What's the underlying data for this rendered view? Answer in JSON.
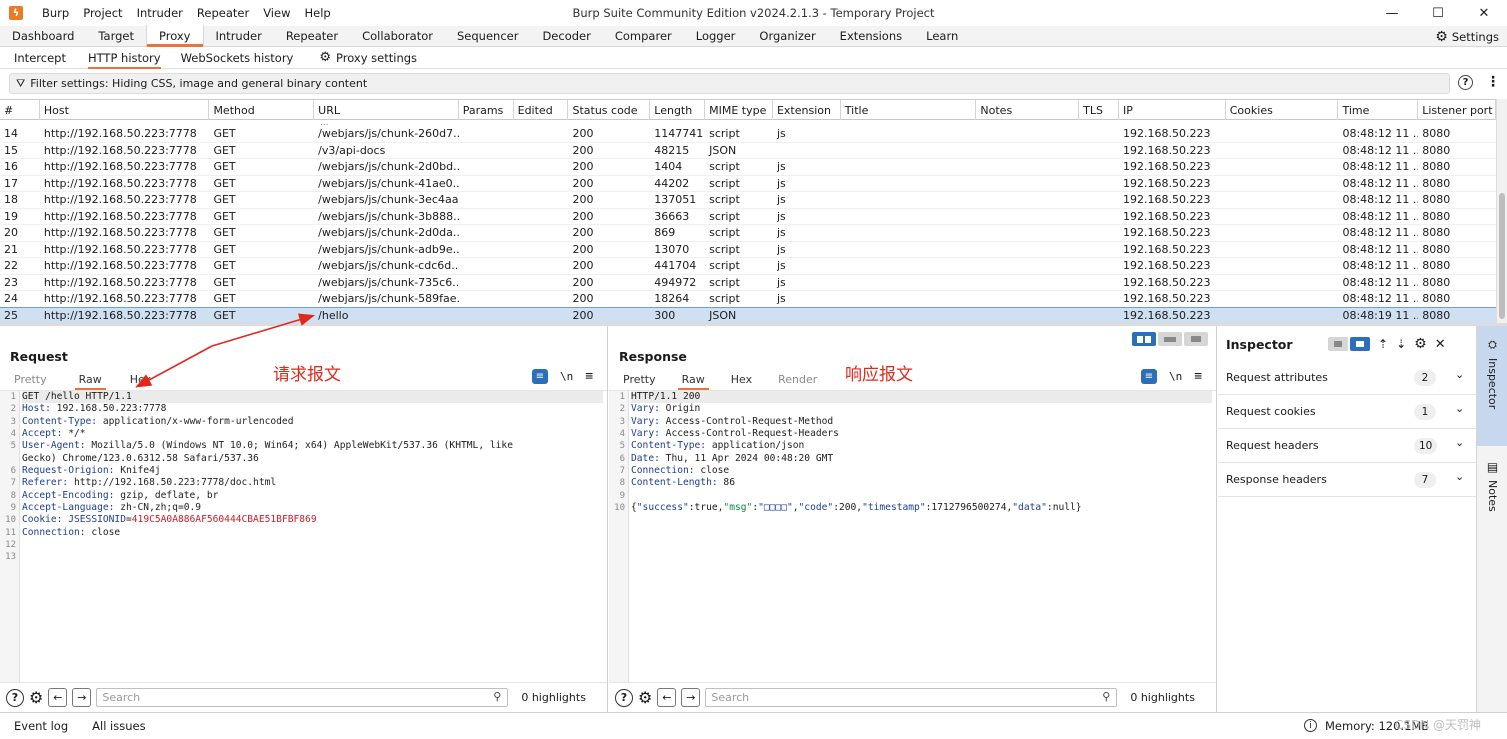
{
  "window": {
    "title": "Burp Suite Community Edition v2024.2.1.3 - Temporary Project",
    "menu": [
      "Burp",
      "Project",
      "Intruder",
      "Repeater",
      "View",
      "Help"
    ],
    "minimize": "—",
    "maximize": "☐",
    "close": "✕"
  },
  "main_tabs": [
    "Dashboard",
    "Target",
    "Proxy",
    "Intruder",
    "Repeater",
    "Collaborator",
    "Sequencer",
    "Decoder",
    "Comparer",
    "Logger",
    "Organizer",
    "Extensions",
    "Learn"
  ],
  "active_main_tab": "Proxy",
  "settings_label": "Settings",
  "sub_tabs": {
    "intercept": "Intercept",
    "http_history": "HTTP history",
    "websockets": "WebSockets history",
    "proxy_settings": "Proxy settings"
  },
  "filter": {
    "text": "Filter settings: Hiding CSS, image and general binary content"
  },
  "table": {
    "columns": [
      "#",
      "Host",
      "Method",
      "URL",
      "Params",
      "Edited",
      "Status code",
      "Length",
      "MIME type",
      "Extension",
      "Title",
      "Notes",
      "TLS",
      "IP",
      "Cookies",
      "Time",
      "Listener port"
    ],
    "partial_row": "...",
    "rows": [
      [
        "14",
        "http://192.168.50.223:7778",
        "GET",
        "/webjars/js/chunk-260d7...",
        "",
        "",
        "200",
        "1147741",
        "script",
        "js",
        "",
        "",
        "",
        "192.168.50.223",
        "",
        "08:48:12 11 ...",
        "8080"
      ],
      [
        "15",
        "http://192.168.50.223:7778",
        "GET",
        "/v3/api-docs",
        "",
        "",
        "200",
        "48215",
        "JSON",
        "",
        "",
        "",
        "",
        "192.168.50.223",
        "",
        "08:48:12 11 ...",
        "8080"
      ],
      [
        "16",
        "http://192.168.50.223:7778",
        "GET",
        "/webjars/js/chunk-2d0bd...",
        "",
        "",
        "200",
        "1404",
        "script",
        "js",
        "",
        "",
        "",
        "192.168.50.223",
        "",
        "08:48:12 11 ...",
        "8080"
      ],
      [
        "17",
        "http://192.168.50.223:7778",
        "GET",
        "/webjars/js/chunk-41ae0...",
        "",
        "",
        "200",
        "44202",
        "script",
        "js",
        "",
        "",
        "",
        "192.168.50.223",
        "",
        "08:48:12 11 ...",
        "8080"
      ],
      [
        "18",
        "http://192.168.50.223:7778",
        "GET",
        "/webjars/js/chunk-3ec4aa...",
        "",
        "",
        "200",
        "137051",
        "script",
        "js",
        "",
        "",
        "",
        "192.168.50.223",
        "",
        "08:48:12 11 ...",
        "8080"
      ],
      [
        "19",
        "http://192.168.50.223:7778",
        "GET",
        "/webjars/js/chunk-3b888...",
        "",
        "",
        "200",
        "36663",
        "script",
        "js",
        "",
        "",
        "",
        "192.168.50.223",
        "",
        "08:48:12 11 ...",
        "8080"
      ],
      [
        "20",
        "http://192.168.50.223:7778",
        "GET",
        "/webjars/js/chunk-2d0da...",
        "",
        "",
        "200",
        "869",
        "script",
        "js",
        "",
        "",
        "",
        "192.168.50.223",
        "",
        "08:48:12 11 ...",
        "8080"
      ],
      [
        "21",
        "http://192.168.50.223:7778",
        "GET",
        "/webjars/js/chunk-adb9e...",
        "",
        "",
        "200",
        "13070",
        "script",
        "js",
        "",
        "",
        "",
        "192.168.50.223",
        "",
        "08:48:12 11 ...",
        "8080"
      ],
      [
        "22",
        "http://192.168.50.223:7778",
        "GET",
        "/webjars/js/chunk-cdc6d...",
        "",
        "",
        "200",
        "441704",
        "script",
        "js",
        "",
        "",
        "",
        "192.168.50.223",
        "",
        "08:48:12 11 ...",
        "8080"
      ],
      [
        "23",
        "http://192.168.50.223:7778",
        "GET",
        "/webjars/js/chunk-735c6...",
        "",
        "",
        "200",
        "494972",
        "script",
        "js",
        "",
        "",
        "",
        "192.168.50.223",
        "",
        "08:48:12 11 ...",
        "8080"
      ],
      [
        "24",
        "http://192.168.50.223:7778",
        "GET",
        "/webjars/js/chunk-589fae...",
        "",
        "",
        "200",
        "18264",
        "script",
        "js",
        "",
        "",
        "",
        "192.168.50.223",
        "",
        "08:48:12 11 ...",
        "8080"
      ],
      [
        "25",
        "http://192.168.50.223:7778",
        "GET",
        "/hello",
        "",
        "",
        "200",
        "300",
        "JSON",
        "",
        "",
        "",
        "",
        "192.168.50.223",
        "",
        "08:48:19 11 ...",
        "8080"
      ]
    ],
    "selected_row": "25"
  },
  "request": {
    "title": "Request",
    "tabs": [
      "Pretty",
      "Raw",
      "Hex"
    ],
    "active_tab": "Raw",
    "lines": [
      "GET /hello HTTP/1.1",
      "Host: 192.168.50.223:7778",
      "Content-Type: application/x-www-form-urlencoded",
      "Accept: */*",
      "User-Agent: Mozilla/5.0 (Windows NT 10.0; Win64; x64) AppleWebKit/537.36 (KHTML, like",
      "Gecko) Chrome/123.0.6312.58 Safari/537.36",
      "Request-Origion: Knife4j",
      "Referer: http://192.168.50.223:7778/doc.html",
      "Accept-Encoding: gzip, deflate, br",
      "Accept-Language: zh-CN,zh;q=0.9",
      "Cookie: JSESSIONID=419C5A0A886AF560444CBAE51BFBF869",
      "Connection: close",
      "",
      ""
    ],
    "line_numbers": [
      "1",
      "2",
      "3",
      "4",
      "5",
      "",
      "6",
      "7",
      "8",
      "9",
      "10",
      "11",
      "12",
      "13"
    ],
    "search_placeholder": "Search",
    "highlights": "0 highlights"
  },
  "response": {
    "title": "Response",
    "tabs": [
      "Pretty",
      "Raw",
      "Hex",
      "Render"
    ],
    "active_tab": "Raw",
    "lines": [
      "HTTP/1.1 200",
      "Vary: Origin",
      "Vary: Access-Control-Request-Method",
      "Vary: Access-Control-Request-Headers",
      "Content-Type: application/json",
      "Date: Thu, 11 Apr 2024 00:48:20 GMT",
      "Connection: close",
      "Content-Length: 86",
      "",
      "{\"success\":true,\"msg\":\"□□□□\",\"code\":200,\"timestamp\":1712796500274,\"data\":null}"
    ],
    "line_numbers": [
      "1",
      "2",
      "3",
      "4",
      "5",
      "6",
      "7",
      "8",
      "9",
      "10"
    ],
    "search_placeholder": "Search",
    "highlights": "0 highlights"
  },
  "inspector": {
    "title": "Inspector",
    "items": [
      {
        "label": "Request attributes",
        "count": "2"
      },
      {
        "label": "Request cookies",
        "count": "1"
      },
      {
        "label": "Request headers",
        "count": "10"
      },
      {
        "label": "Response headers",
        "count": "7"
      }
    ]
  },
  "sidebar": {
    "inspector": "Inspector",
    "notes": "Notes"
  },
  "statusbar": {
    "event_log": "Event log",
    "all_issues": "All issues",
    "memory": "Memory: 120.1MB",
    "watermark": "CSDN @天罚神"
  },
  "annotations": {
    "request": "请求报文",
    "response": "响应报文",
    "color": "#e0281c"
  },
  "colors": {
    "accent": "#e8743b",
    "selected_row": "#cfe0f3",
    "blue_button": "#2b6fb8"
  }
}
